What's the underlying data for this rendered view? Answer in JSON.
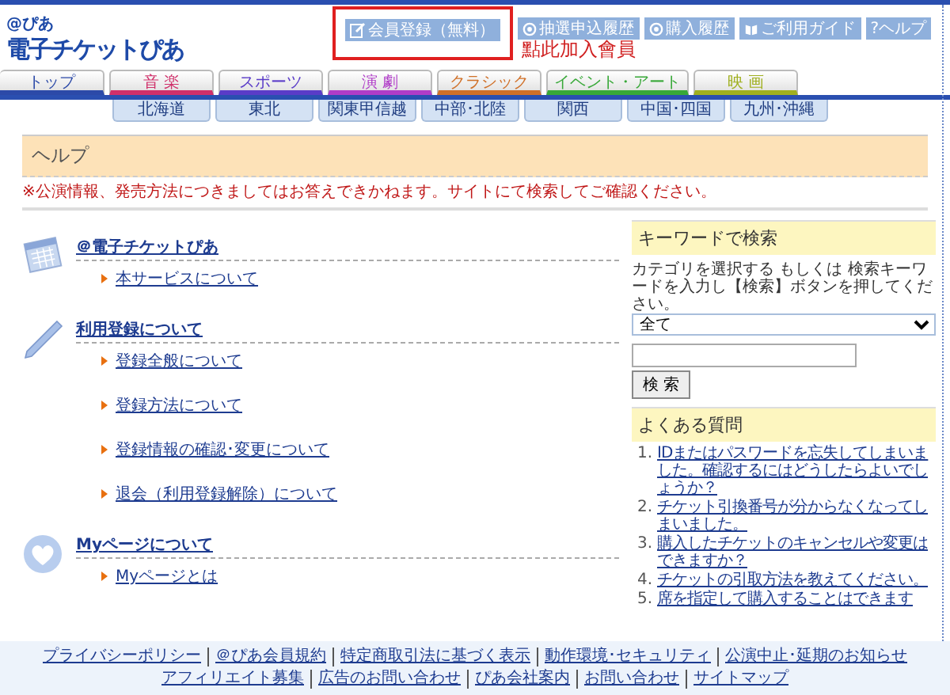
{
  "header": {
    "logo_small": "@ぴあ",
    "logo": "電子チケットぴあ",
    "buttons": [
      {
        "label": "会員登録（無料）",
        "highlighted": true
      },
      {
        "label": "抽選申込履歴",
        "highlighted": false
      },
      {
        "label": "購入履歴",
        "highlighted": false
      },
      {
        "label": "ご利用ガイド",
        "highlighted": false
      },
      {
        "label": "?ヘルプ",
        "highlighted": false
      }
    ],
    "annotation": "點此加入會員"
  },
  "tabs": [
    {
      "label": "トップ",
      "color": "#2c4aa8"
    },
    {
      "label": "音 楽",
      "color": "#d0306a"
    },
    {
      "label": "スポーツ",
      "color": "#5a3cc8"
    },
    {
      "label": "演 劇",
      "color": "#b03cc8"
    },
    {
      "label": "クラシック",
      "color": "#d07028"
    },
    {
      "label": "イベント・アート",
      "color": "#38a838"
    },
    {
      "label": "映 画",
      "color": "#a0b020"
    }
  ],
  "subtabs": [
    "北海道",
    "東北",
    "関東甲信越",
    "中部･北陸",
    "関西",
    "中国･四国",
    "九州･沖縄"
  ],
  "page_title": "ヘルプ",
  "notice": "※公演情報、発売方法につきましてはお答えできかねます。サイトにて検索してご確認ください。",
  "sections": [
    {
      "title": "＠電子チケットぴあ",
      "links": [
        "本サービスについて"
      ]
    },
    {
      "title": "利用登録について",
      "links": [
        "登録全般について",
        "登録方法について",
        "登録情報の確認･変更について",
        "退会（利用登録解除）について"
      ]
    },
    {
      "title": "Myページについて",
      "links": [
        "Myページとは"
      ]
    }
  ],
  "search": {
    "title": "キーワードで検索",
    "description": "カテゴリを選択する もしくは 検索キーワードを入力し【検索】ボタンを押してください。",
    "category": "全て",
    "button": "検 索"
  },
  "faq": {
    "title": "よくある質問",
    "items": [
      {
        "number": "1.",
        "text": "IDまたはパスワードを忘失してしまいました。確認するにはどうしたらよいでしょうか？"
      },
      {
        "number": "2.",
        "text": "チケット引換番号が分からなくなってしまいました。"
      },
      {
        "number": "3.",
        "text": "購入したチケットのキャンセルや変更はできますか？"
      },
      {
        "number": "4.",
        "text": "チケットの引取方法を教えてください。"
      },
      {
        "number": "5.",
        "text": "席を指定して購入することはできます"
      }
    ]
  },
  "footer": {
    "upper_links": [
      "プライバシーポリシー",
      "＠ぴあ会員規約",
      "特定商取引法に基づく表示",
      "動作環境･セキュリティ",
      "公演中止･延期のお知らせ"
    ],
    "lower_links": [
      "アフィリエイト募集",
      "広告のお問い合わせ",
      "ぴあ会社案内",
      "お問い合わせ",
      "サイトマップ"
    ]
  }
}
